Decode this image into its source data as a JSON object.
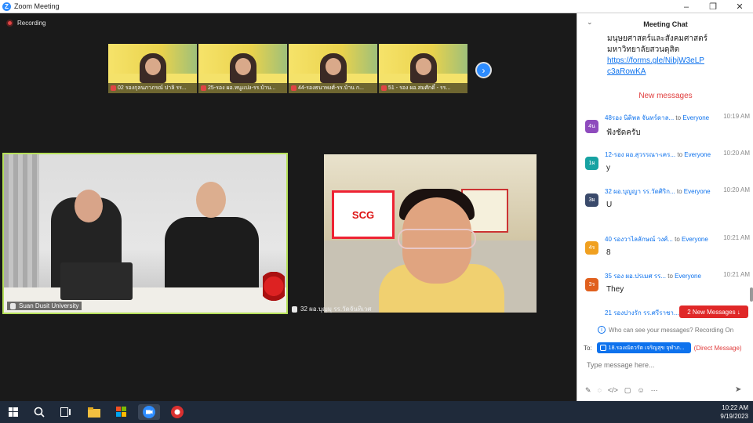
{
  "window": {
    "title": "Zoom Meeting",
    "controls": [
      "–",
      "❐",
      "✕"
    ]
  },
  "recording": {
    "label": "Recording"
  },
  "thumbnails": [
    {
      "name": "02 รองกุลนภาภรณ์ ปาลิ รร..."
    },
    {
      "name": "25-รอง ผอ.หนูแปง-รร.บ้าน..."
    },
    {
      "name": "44-รองธนาพงศ์-รร.บ้าน ก..."
    },
    {
      "name": "51 - รอง ผอ.สมศักดิ์ - รร..."
    }
  ],
  "next_label": "›",
  "tiles": {
    "left_name": "Suan Dusit University",
    "right_name": "32 ผอ.บุญมุ รร.วัดจันทิเวศ",
    "sign_text": "SCG"
  },
  "chat": {
    "title": "Meeting Chat",
    "previous_text": "มนุษยศาสตร์และสังคมศาสตร์ มหาวิทยาลัยสวนดุสิต",
    "previous_link_1": "https://forms.gle/NibjW3eLP",
    "previous_link_2": "c3aRowKA",
    "new_messages_label": "New messages",
    "messages": [
      {
        "avatar": "4น",
        "color": "#8e4bbd",
        "sender": "48รอง นิติพล จันทร์ดาล...",
        "to": "to",
        "target": "Everyone",
        "time": "10:19 AM",
        "text": "ฟังชัดครับ"
      },
      {
        "avatar": "1ผ",
        "color": "#17a2a2",
        "sender": "12-รอง ผอ.สุวรรณา-เคร...",
        "to": "to",
        "target": "Everyone",
        "time": "10:20 AM",
        "text": "y"
      },
      {
        "avatar": "3ผ",
        "color": "#3a4a6b",
        "sender": "32 ผอ.บุญญา รร.วัดศิริก...",
        "to": "to",
        "target": "Everyone",
        "time": "10:20 AM",
        "text": "U"
      },
      {
        "avatar": "4ร",
        "color": "#f0a020",
        "sender": "40 รองวาไลลักษณ์ วงศ์...",
        "to": "to",
        "target": "Everyone",
        "time": "10:21 AM",
        "text": "8"
      },
      {
        "avatar": "3ร",
        "color": "#e0601e",
        "sender": "35 รอง ผอ.ปรเมศ รร...",
        "to": "to",
        "target": "Everyone",
        "time": "10:21 AM",
        "text": "They"
      },
      {
        "avatar": "2ร",
        "color": "#f0a020",
        "sender": "21 รองปางรัก รร.ศรีราชา...",
        "to": "to",
        "target": "Everyone",
        "time": "",
        "text": ""
      }
    ],
    "new_messages_badge": "2 New Messages ↓",
    "who_can_see": "Who can see your messages? Recording On",
    "to_label": "To:",
    "recipient": "18.รองณัตวรัต เจริญสุข จุฬาภ...",
    "direct_message": "(Direct Message)",
    "input_placeholder": "Type message here...",
    "send_icon": "send-icon"
  },
  "taskbar": {
    "time": "10:22 AM",
    "date": "9/19/2023"
  }
}
